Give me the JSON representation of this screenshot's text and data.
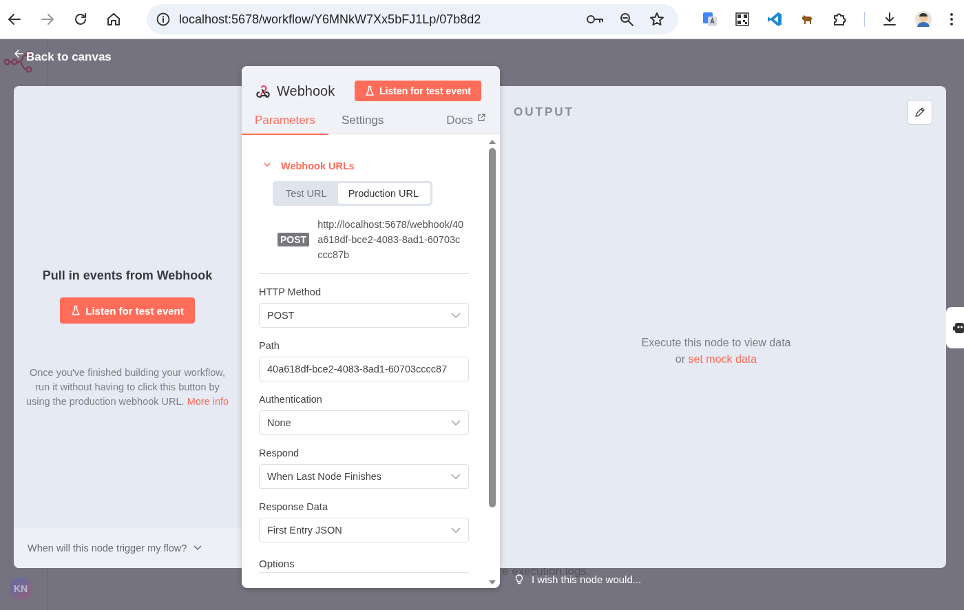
{
  "browser": {
    "url": "localhost:5678/workflow/Y6MNkW7Xx5bFJ1Lp/07b8d2"
  },
  "back_link": "Back to canvas",
  "background_hint": "e execution logs.",
  "trigger_panel": {
    "title": "Pull in events from Webhook",
    "button": "Listen for test event",
    "description": "Once you've finished building your workflow, run it without having to click this button by using the production webhook URL.",
    "link": "More info",
    "footer": "When will this node trigger my flow?"
  },
  "node_panel": {
    "title": "Webhook",
    "listen_button": "Listen for test event",
    "tabs": [
      {
        "label": "Parameters",
        "selected": true
      },
      {
        "label": "Settings",
        "selected": false
      }
    ],
    "docs_link": "Docs",
    "section": {
      "title": "Webhook URLs",
      "expanded": true,
      "url_tabs": [
        {
          "label": "Test URL",
          "selected": false
        },
        {
          "label": "Production URL",
          "selected": true
        }
      ],
      "method": "POST",
      "url": "http://localhost:5678/webhook/40a618df-bce2-4083-8ad1-60703cccc87b"
    },
    "fields": [
      {
        "label": "HTTP Method",
        "kind": "select",
        "value": "POST"
      },
      {
        "label": "Path",
        "kind": "text",
        "value": "40a618df-bce2-4083-8ad1-60703cccc87"
      },
      {
        "label": "Authentication",
        "kind": "select",
        "value": "None"
      },
      {
        "label": "Respond",
        "kind": "select",
        "value": "When Last Node Finishes"
      },
      {
        "label": "Response Data",
        "kind": "select",
        "value": "First Entry JSON"
      }
    ],
    "options_label": "Options"
  },
  "output": {
    "title": "OUTPUT",
    "message": "Execute this node to view data",
    "prefix": "or",
    "link": "set mock data"
  },
  "feedback": "I wish this node would...",
  "user_avatar": "KN"
}
